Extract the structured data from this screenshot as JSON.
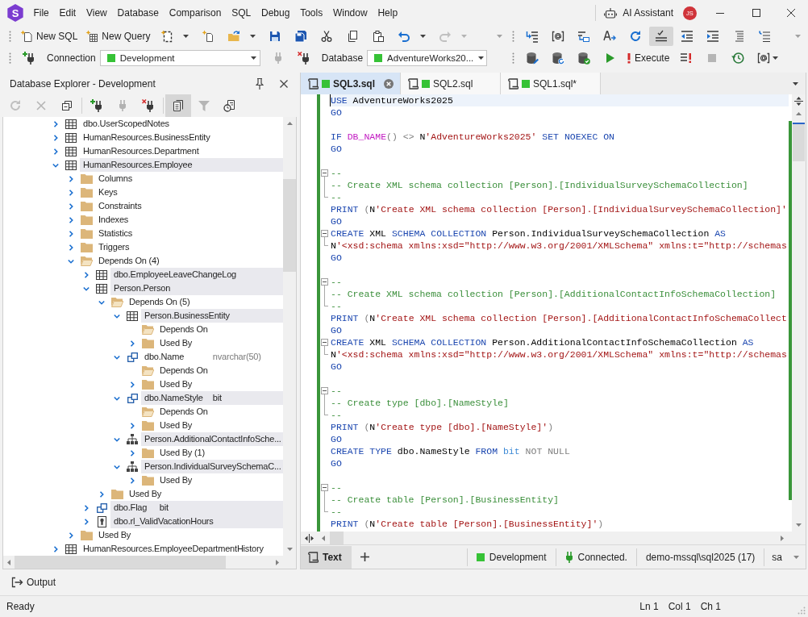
{
  "app": {
    "logo": "S",
    "menu": [
      "File",
      "Edit",
      "View",
      "Database",
      "Comparison",
      "SQL",
      "Debug",
      "Tools",
      "Window",
      "Help"
    ],
    "assistant": "AI Assistant",
    "avatar": "JS"
  },
  "toolbar_main": {
    "groups": [
      [
        {
          "label": "New SQL",
          "disabled": false,
          "on": false
        },
        {
          "label": "New Query",
          "disabled": false,
          "on": false
        },
        {
          "disabled": false,
          "on": false
        },
        {
          "disabled": false,
          "on": false
        },
        {
          "disabled": false,
          "on": false
        },
        {
          "disabled": false,
          "on": false
        },
        {
          "disabled": false,
          "on": false
        },
        {
          "disabled": false,
          "on": false
        },
        {
          "disabled": false,
          "on": false
        },
        {
          "disabled": false,
          "on": false
        },
        {
          "disabled": false,
          "on": false
        },
        {
          "disabled": true,
          "on": false
        }
      ],
      [
        {
          "disabled": false,
          "on": false
        },
        {
          "disabled": false,
          "on": false
        },
        {
          "disabled": false,
          "on": false
        },
        {
          "disabled": false,
          "on": false
        },
        {
          "disabled": false,
          "on": false
        },
        {
          "disabled": false,
          "on": true
        },
        {
          "disabled": false,
          "on": false
        },
        {
          "disabled": false,
          "on": false
        },
        {
          "disabled": false,
          "on": false
        },
        {
          "disabled": false,
          "on": false
        }
      ]
    ]
  },
  "toolbar_connection": {
    "groups": [
      [
        {
          "kind": "button",
          "disabled": false,
          "on": false
        },
        {
          "kind": "label",
          "text": "Connection"
        },
        {
          "kind": "combo",
          "value": "Development",
          "color": "#36c236"
        },
        {
          "kind": "button",
          "disabled": true,
          "on": false
        },
        {
          "kind": "button",
          "disabled": false,
          "on": false
        },
        {
          "kind": "label",
          "text": "Database"
        },
        {
          "kind": "combo",
          "value": "AdventureWorks20...",
          "color": "#36c236"
        }
      ],
      [
        {
          "kind": "button",
          "disabled": false,
          "on": false
        },
        {
          "kind": "button",
          "disabled": false,
          "on": false
        },
        {
          "kind": "button",
          "disabled": false,
          "on": false
        },
        {
          "kind": "button",
          "disabled": false,
          "on": false
        },
        {
          "kind": "button",
          "label": "Execute",
          "disabled": false,
          "on": false
        },
        {
          "kind": "button",
          "disabled": false,
          "on": false
        },
        {
          "kind": "button",
          "disabled": true,
          "on": false
        },
        {
          "kind": "button",
          "disabled": false,
          "on": false
        },
        {
          "kind": "button",
          "disabled": false,
          "on": false
        }
      ]
    ]
  },
  "explorer": {
    "title": "Database Explorer - Development",
    "tools": [
      [
        {
          "disabled": true,
          "on": false
        },
        {
          "disabled": true,
          "on": false
        },
        {
          "disabled": false,
          "on": false
        }
      ],
      [
        {
          "disabled": false,
          "on": false
        },
        {
          "disabled": true,
          "on": false
        },
        {
          "disabled": false,
          "on": false
        }
      ],
      [
        {
          "disabled": false,
          "on": true
        },
        {
          "disabled": true,
          "on": false
        },
        {
          "disabled": false,
          "on": false
        }
      ]
    ],
    "tree": [
      {
        "label": "dbo.UserScopedNotes",
        "kind": "table",
        "expanded": false,
        "highlighted": false
      },
      {
        "label": "HumanResources.BusinessEntity",
        "kind": "table",
        "expanded": false,
        "highlighted": false
      },
      {
        "label": "HumanResources.Department",
        "kind": "table",
        "expanded": false,
        "highlighted": false
      },
      {
        "label": "HumanResources.Employee",
        "kind": "table",
        "expanded": true,
        "highlighted": true,
        "children": [
          {
            "label": "Columns",
            "kind": "folder",
            "expanded": false,
            "highlighted": false
          },
          {
            "label": "Keys",
            "kind": "folder",
            "expanded": false,
            "highlighted": false
          },
          {
            "label": "Constraints",
            "kind": "folder",
            "expanded": false,
            "highlighted": false
          },
          {
            "label": "Indexes",
            "kind": "folder",
            "expanded": false,
            "highlighted": false
          },
          {
            "label": "Statistics",
            "kind": "folder",
            "expanded": false,
            "highlighted": false
          },
          {
            "label": "Triggers",
            "kind": "folder",
            "expanded": false,
            "highlighted": false
          },
          {
            "label": "Depends On (4)",
            "kind": "folder",
            "expanded": true,
            "highlighted": false,
            "children": [
              {
                "label": "dbo.EmployeeLeaveChangeLog",
                "kind": "table",
                "expanded": false,
                "highlighted": true
              },
              {
                "label": "Person.Person",
                "kind": "table",
                "expanded": true,
                "highlighted": true,
                "children": [
                  {
                    "label": "Depends On (5)",
                    "kind": "folder",
                    "expanded": true,
                    "highlighted": false,
                    "children": [
                      {
                        "label": "Person.BusinessEntity",
                        "kind": "table",
                        "expanded": true,
                        "highlighted": true,
                        "children": [
                          {
                            "label": "Depends On",
                            "kind": "folder",
                            "expanded": true,
                            "highlighted": false
                          },
                          {
                            "label": "Used By",
                            "kind": "folder",
                            "expanded": false,
                            "highlighted": false
                          }
                        ]
                      },
                      {
                        "label": "dbo.Name",
                        "detail": "nvarchar(50)",
                        "kind": "type",
                        "expanded": true,
                        "highlighted": false,
                        "children": [
                          {
                            "label": "Depends On",
                            "kind": "folder",
                            "expanded": true,
                            "highlighted": false
                          },
                          {
                            "label": "Used By",
                            "kind": "folder",
                            "expanded": false,
                            "highlighted": false
                          }
                        ]
                      },
                      {
                        "label": "dbo.NameStyle",
                        "detail": "bit",
                        "kind": "type",
                        "expanded": true,
                        "highlighted": true,
                        "children": [
                          {
                            "label": "Depends On",
                            "kind": "folder",
                            "expanded": true,
                            "highlighted": false
                          },
                          {
                            "label": "Used By",
                            "kind": "folder",
                            "expanded": false,
                            "highlighted": false
                          }
                        ]
                      },
                      {
                        "label": "Person.AdditionalContactInfoSche...",
                        "kind": "schema",
                        "expanded": true,
                        "highlighted": true,
                        "children": [
                          {
                            "label": "Used By (1)",
                            "kind": "folder",
                            "expanded": false,
                            "highlighted": false
                          }
                        ]
                      },
                      {
                        "label": "Person.IndividualSurveySchemaC...",
                        "kind": "schema",
                        "expanded": true,
                        "highlighted": true,
                        "children": [
                          {
                            "label": "Used By",
                            "kind": "folder",
                            "expanded": false,
                            "highlighted": false
                          }
                        ]
                      }
                    ]
                  },
                  {
                    "label": "Used By",
                    "kind": "folder",
                    "expanded": false,
                    "highlighted": false
                  }
                ]
              },
              {
                "label": "dbo.Flag",
                "detail": "bit",
                "kind": "type",
                "expanded": false,
                "highlighted": true
              },
              {
                "label": "dbo.rl_ValidVacationHours",
                "kind": "rule",
                "expanded": false,
                "highlighted": true
              }
            ]
          },
          {
            "label": "Used By",
            "kind": "folder",
            "expanded": false,
            "highlighted": false
          }
        ]
      },
      {
        "label": "HumanResources.EmployeeDepartmentHistory",
        "kind": "table",
        "expanded": false,
        "highlighted": false
      }
    ]
  },
  "editor": {
    "tabs": [
      {
        "label": "SQL3.sql",
        "selected": true,
        "color": "#36c236"
      },
      {
        "label": "SQL2.sql",
        "selected": false,
        "color": "#36c236"
      },
      {
        "label": "SQL1.sql*",
        "selected": false,
        "color": "#36c236"
      }
    ],
    "lines": [
      {
        "tokens": [
          {
            "text": "USE ",
            "kind": "keyword"
          },
          {
            "text": "AdventureWorks2025",
            "kind": "plain"
          }
        ],
        "fold_start": false,
        "in_fold": false,
        "current": true
      },
      {
        "tokens": [
          {
            "text": "GO",
            "kind": "keyword"
          }
        ],
        "fold_start": false,
        "in_fold": false,
        "current": false
      },
      {
        "fold_start": false,
        "in_fold": false,
        "current": false
      },
      {
        "tokens": [
          {
            "text": "IF ",
            "kind": "keyword"
          },
          {
            "text": "DB_NAME",
            "kind": "function"
          },
          {
            "text": "() <> ",
            "kind": "operator"
          },
          {
            "text": "N",
            "kind": "plain"
          },
          {
            "text": "'AdventureWorks2025' ",
            "kind": "string"
          },
          {
            "text": "SET NOEXEC ON",
            "kind": "keyword"
          }
        ],
        "fold_start": false,
        "in_fold": false,
        "current": false
      },
      {
        "tokens": [
          {
            "text": "GO",
            "kind": "keyword"
          }
        ],
        "fold_start": false,
        "in_fold": false,
        "current": false
      },
      {
        "fold_start": false,
        "in_fold": false,
        "current": false
      },
      {
        "tokens": [
          {
            "text": "--",
            "kind": "comment"
          }
        ],
        "fold_start": true,
        "in_fold": false,
        "current": false
      },
      {
        "tokens": [
          {
            "text": "-- Create XML schema collection [Person].[IndividualSurveySchemaCollection]",
            "kind": "comment"
          }
        ],
        "fold_start": false,
        "in_fold": true,
        "current": false
      },
      {
        "tokens": [
          {
            "text": "--",
            "kind": "comment"
          }
        ],
        "fold_start": false,
        "in_fold": true,
        "current": false
      },
      {
        "tokens": [
          {
            "text": "PRINT ",
            "kind": "keyword"
          },
          {
            "text": "(",
            "kind": "operator"
          },
          {
            "text": "N",
            "kind": "plain"
          },
          {
            "text": "'Create XML schema collection [Person].[IndividualSurveySchemaCollection]'",
            "kind": "string"
          }
        ],
        "fold_start": false,
        "in_fold": false,
        "current": false
      },
      {
        "tokens": [
          {
            "text": "GO",
            "kind": "keyword"
          }
        ],
        "fold_start": false,
        "in_fold": false,
        "current": false
      },
      {
        "tokens": [
          {
            "text": "CREATE ",
            "kind": "keyword"
          },
          {
            "text": "XML ",
            "kind": "plain"
          },
          {
            "text": "SCHEMA COLLECTION ",
            "kind": "keyword"
          },
          {
            "text": "Person.IndividualSurveySchemaCollection ",
            "kind": "plain"
          },
          {
            "text": "AS",
            "kind": "keyword"
          }
        ],
        "fold_start": true,
        "in_fold": false,
        "current": false
      },
      {
        "tokens": [
          {
            "text": "N",
            "kind": "plain"
          },
          {
            "text": "'<xsd:schema xmlns:xsd=\"http://www.w3.org/2001/XMLSchema\" xmlns:t=\"http://schemas",
            "kind": "string"
          }
        ],
        "fold_start": false,
        "in_fold": true,
        "current": false
      },
      {
        "tokens": [
          {
            "text": "GO",
            "kind": "keyword"
          }
        ],
        "fold_start": false,
        "in_fold": false,
        "current": false
      },
      {
        "fold_start": false,
        "in_fold": false,
        "current": false
      },
      {
        "tokens": [
          {
            "text": "--",
            "kind": "comment"
          }
        ],
        "fold_start": true,
        "in_fold": false,
        "current": false
      },
      {
        "tokens": [
          {
            "text": "-- Create XML schema collection [Person].[AdditionalContactInfoSchemaCollection]",
            "kind": "comment"
          }
        ],
        "fold_start": false,
        "in_fold": true,
        "current": false
      },
      {
        "tokens": [
          {
            "text": "--",
            "kind": "comment"
          }
        ],
        "fold_start": false,
        "in_fold": true,
        "current": false
      },
      {
        "tokens": [
          {
            "text": "PRINT ",
            "kind": "keyword"
          },
          {
            "text": "(",
            "kind": "operator"
          },
          {
            "text": "N",
            "kind": "plain"
          },
          {
            "text": "'Create XML schema collection [Person].[AdditionalContactInfoSchemaCollect",
            "kind": "string"
          }
        ],
        "fold_start": false,
        "in_fold": false,
        "current": false
      },
      {
        "tokens": [
          {
            "text": "GO",
            "kind": "keyword"
          }
        ],
        "fold_start": false,
        "in_fold": false,
        "current": false
      },
      {
        "tokens": [
          {
            "text": "CREATE ",
            "kind": "keyword"
          },
          {
            "text": "XML ",
            "kind": "plain"
          },
          {
            "text": "SCHEMA COLLECTION ",
            "kind": "keyword"
          },
          {
            "text": "Person.AdditionalContactInfoSchemaCollection ",
            "kind": "plain"
          },
          {
            "text": "AS",
            "kind": "keyword"
          }
        ],
        "fold_start": true,
        "in_fold": false,
        "current": false
      },
      {
        "tokens": [
          {
            "text": "N",
            "kind": "plain"
          },
          {
            "text": "'<xsd:schema xmlns:xsd=\"http://www.w3.org/2001/XMLSchema\" xmlns:t=\"http://schemas",
            "kind": "string"
          }
        ],
        "fold_start": false,
        "in_fold": true,
        "current": false
      },
      {
        "tokens": [
          {
            "text": "GO",
            "kind": "keyword"
          }
        ],
        "fold_start": false,
        "in_fold": false,
        "current": false
      },
      {
        "fold_start": false,
        "in_fold": false,
        "current": false
      },
      {
        "tokens": [
          {
            "text": "--",
            "kind": "comment"
          }
        ],
        "fold_start": true,
        "in_fold": false,
        "current": false
      },
      {
        "tokens": [
          {
            "text": "-- Create type [dbo].[NameStyle]",
            "kind": "comment"
          }
        ],
        "fold_start": false,
        "in_fold": true,
        "current": false
      },
      {
        "tokens": [
          {
            "text": "--",
            "kind": "comment"
          }
        ],
        "fold_start": false,
        "in_fold": true,
        "current": false
      },
      {
        "tokens": [
          {
            "text": "PRINT ",
            "kind": "keyword"
          },
          {
            "text": "(",
            "kind": "operator"
          },
          {
            "text": "N",
            "kind": "plain"
          },
          {
            "text": "'Create type [dbo].[NameStyle]'",
            "kind": "string"
          },
          {
            "text": ")",
            "kind": "operator"
          }
        ],
        "fold_start": false,
        "in_fold": false,
        "current": false
      },
      {
        "tokens": [
          {
            "text": "GO",
            "kind": "keyword"
          }
        ],
        "fold_start": false,
        "in_fold": false,
        "current": false
      },
      {
        "tokens": [
          {
            "text": "CREATE TYPE ",
            "kind": "keyword"
          },
          {
            "text": "dbo.NameStyle ",
            "kind": "plain"
          },
          {
            "text": "FROM ",
            "kind": "keyword"
          },
          {
            "text": "bit ",
            "kind": "datatype"
          },
          {
            "text": "NOT NULL",
            "kind": "operator"
          }
        ],
        "fold_start": false,
        "in_fold": false,
        "current": false
      },
      {
        "tokens": [
          {
            "text": "GO",
            "kind": "keyword"
          }
        ],
        "fold_start": false,
        "in_fold": false,
        "current": false
      },
      {
        "fold_start": false,
        "in_fold": false,
        "current": false
      },
      {
        "tokens": [
          {
            "text": "--",
            "kind": "comment"
          }
        ],
        "fold_start": true,
        "in_fold": false,
        "current": false
      },
      {
        "tokens": [
          {
            "text": "-- Create table [Person].[BusinessEntity]",
            "kind": "comment"
          }
        ],
        "fold_start": false,
        "in_fold": true,
        "current": false
      },
      {
        "tokens": [
          {
            "text": "--",
            "kind": "comment"
          }
        ],
        "fold_start": false,
        "in_fold": true,
        "current": false
      },
      {
        "tokens": [
          {
            "text": "PRINT ",
            "kind": "keyword"
          },
          {
            "text": "(",
            "kind": "operator"
          },
          {
            "text": "N",
            "kind": "plain"
          },
          {
            "text": "'Create table [Person].[BusinessEntity]'",
            "kind": "string"
          },
          {
            "text": ")",
            "kind": "operator"
          }
        ],
        "fold_start": false,
        "in_fold": false,
        "current": false
      }
    ],
    "views": [
      {
        "label": "Text",
        "selected": true
      }
    ],
    "status": [
      {
        "kind": "environment",
        "text": "Development",
        "color": "#36c236"
      },
      {
        "kind": "connection",
        "text": "Connected."
      },
      {
        "kind": "server",
        "text": "demo-mssql\\sql2025 (17)"
      },
      {
        "kind": "user",
        "text": "sa"
      }
    ]
  },
  "output": {
    "label": "Output"
  },
  "status_bar": {
    "message": "Ready",
    "position": [
      "Ln 1",
      "Col 1",
      "Ch 1"
    ]
  }
}
